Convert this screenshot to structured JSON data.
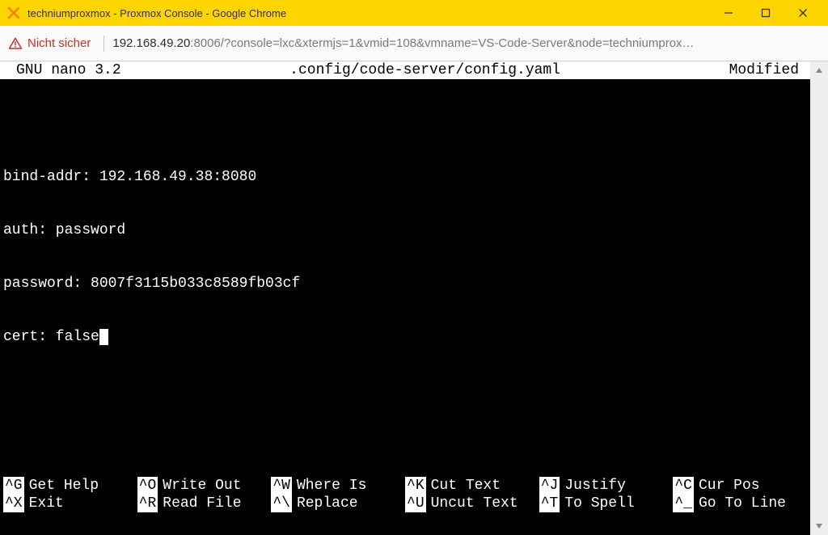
{
  "window": {
    "title": "techniumproxmox - Proxmox Console - Google Chrome"
  },
  "address_bar": {
    "security_label": "Nicht sicher",
    "url_host": "192.168.49.20",
    "url_port_path": ":8006/?console=lxc&xtermjs=1&vmid=108&vmname=VS-Code-Server&node=techniumprox…"
  },
  "nano": {
    "app": "GNU nano 3.2",
    "filepath": ".config/code-server/config.yaml",
    "status": "Modified"
  },
  "file_contents": {
    "lines": [
      "",
      "bind-addr: 192.168.49.38:8080",
      "auth: password",
      "password: 8007f3115b033c8589fb03cf",
      "cert: false"
    ]
  },
  "help": {
    "row1": [
      {
        "key": "^G",
        "label": "Get Help"
      },
      {
        "key": "^O",
        "label": "Write Out"
      },
      {
        "key": "^W",
        "label": "Where Is"
      },
      {
        "key": "^K",
        "label": "Cut Text"
      },
      {
        "key": "^J",
        "label": "Justify"
      },
      {
        "key": "^C",
        "label": "Cur Pos"
      }
    ],
    "row2": [
      {
        "key": "^X",
        "label": "Exit"
      },
      {
        "key": "^R",
        "label": "Read File"
      },
      {
        "key": "^\\",
        "label": "Replace"
      },
      {
        "key": "^U",
        "label": "Uncut Text"
      },
      {
        "key": "^T",
        "label": "To Spell"
      },
      {
        "key": "^_",
        "label": "Go To Line"
      }
    ]
  }
}
